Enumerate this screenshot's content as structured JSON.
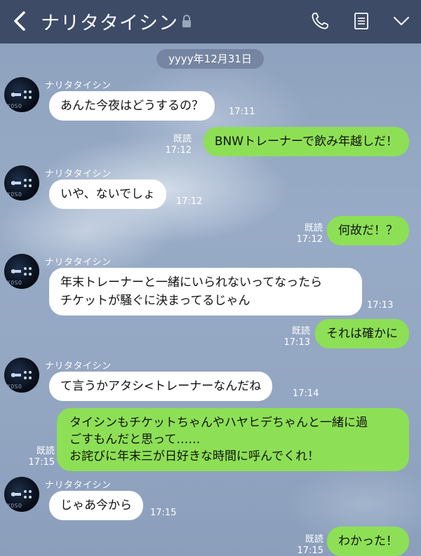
{
  "header": {
    "contact_name": "ナリタタイシン",
    "icons": [
      "back-arrow-icon",
      "lock-icon",
      "phone-icon",
      "notes-icon",
      "chevron-down-icon"
    ]
  },
  "date_separator": "yyyy年12月31日",
  "read_label": "既読",
  "messages": [
    {
      "from": "ナリタタイシン",
      "text": "あんた今夜はどうするの？",
      "time": "17:11"
    },
    {
      "from": "me",
      "text": "BNWトレーナーで飲み年越しだ！",
      "time": "17:12",
      "read": "既読"
    },
    {
      "from": "ナリタタイシン",
      "text": "いや、ないでしょ",
      "time": "17:12"
    },
    {
      "from": "me",
      "text": "何故だ！？",
      "time": "17:12",
      "read": "既読"
    },
    {
      "from": "ナリタタイシン",
      "text": "年末トレーナーと一緒にいられないってなったら\nチケットが騒ぐに決まってるじゃん",
      "time": "17:13"
    },
    {
      "from": "me",
      "text": "それは確かに",
      "time": "17:13",
      "read": "既読"
    },
    {
      "from": "ナリタタイシン",
      "text": "て言うかアタシ<トレーナーなんだね",
      "time": "17:14"
    },
    {
      "from": "me",
      "text": "タイシンもチケットちゃんやハヤヒデちゃんと一緒に過\nごすもんだと思って……\nお詫びに年末三が日好きな時間に呼んでくれ！",
      "time": "17:15",
      "read": "既読"
    },
    {
      "from": "ナリタタイシン",
      "text": "じゃあ今から",
      "time": "17:15"
    },
    {
      "from": "me",
      "text": "わかった！",
      "time": "17:15",
      "read": "既読"
    }
  ],
  "avatar_text": "KOSO",
  "colors": {
    "header_bg": "#3d4b67",
    "outgoing_bubble": "#8de055",
    "incoming_bubble": "#ffffff",
    "background": "#93a6c2"
  }
}
